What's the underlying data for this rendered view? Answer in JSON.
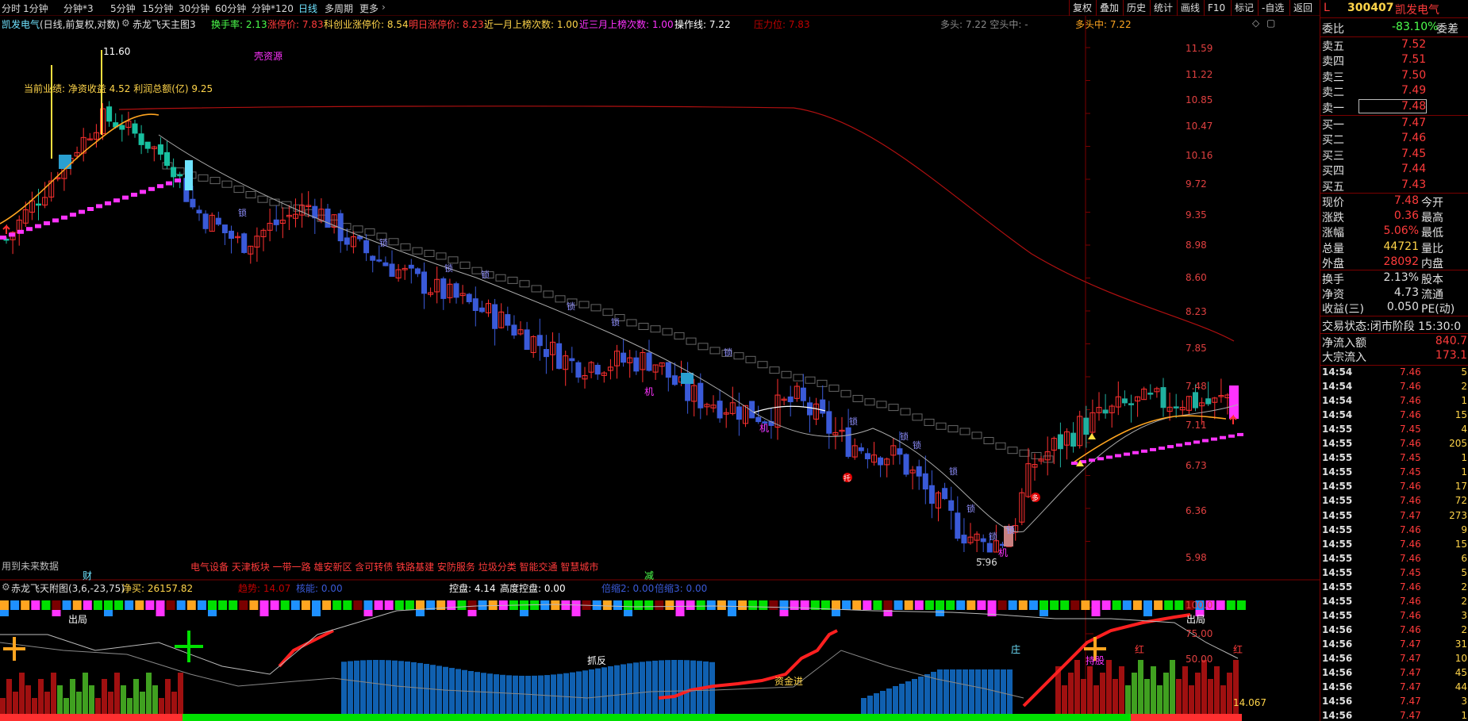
{
  "toolbar": {
    "periods": [
      "分时",
      "1分钟",
      "分钟*3",
      "5分钟",
      "15分钟",
      "30分钟",
      "60分钟",
      "分钟*120",
      "日线",
      "多周期",
      "更多"
    ],
    "active_period": "日线",
    "buttons": [
      "复权",
      "叠加",
      "历史",
      "统计",
      "画线",
      "F10",
      "标记",
      "-自选",
      "返回"
    ]
  },
  "info": {
    "stock_name": "凯发电气",
    "fq_mode": "(日线,前复权,对数)",
    "main_indicator": "赤龙飞天主图3",
    "turnover": "换手率: 2.13",
    "limit_up": "涨停价: 7.83",
    "kc_limit": "科创业涨停价: 8.54",
    "next_limit": "明日涨停价: 8.23",
    "m1_count": "近一月上榜次数: 1.00",
    "m3_count": "近三月上榜次数: 1.00",
    "op_line": "操作线: 7.22",
    "pressure": "压力位: 7.83",
    "bull_empty": "多头: 7.22  空头中: -",
    "bull_mid": "多头中: 7.22"
  },
  "chart": {
    "y_ticks": [
      "11.59",
      "11.22",
      "10.85",
      "10.47",
      "10.16",
      "9.72",
      "9.35",
      "8.98",
      "8.60",
      "8.23",
      "7.85",
      "7.48",
      "7.11",
      "6.73",
      "6.36",
      "5.98"
    ],
    "high_label": "11.60",
    "low_label": "5.96",
    "shell_label": "壳资源",
    "perf_label": "当前业绩: 净资收益 4.52 利润总额(亿) 9.25",
    "future_label": "用到未来数据",
    "cai_label": "财",
    "jian_label": "减",
    "concepts": "电气设备 天津板块 一带一路 雄安新区 含可转债 铁路基建 安防服务 垃圾分类 智能交通 智慧城市",
    "suo_label": "锁",
    "ji_label": "机",
    "tuo_label": "托",
    "duo_label": "多"
  },
  "sub": {
    "title": "赤龙飞天附图(3,6,-23,75)",
    "net_buy": "净买: 26157.82",
    "trend": "趋势: 14.07",
    "kinetic": "核能: 0.00",
    "control": "控盘: 4.14",
    "high_control": "高度控盘: 0.00",
    "shrink2": "倍缩2: 0.00",
    "shrink3": "倍缩3: 0.00",
    "y_ticks": [
      "100.0",
      "75.00",
      "50.00"
    ],
    "out_label": "出局",
    "zhuafan": "抓反",
    "zijin": "资金进",
    "zhuang": "庄",
    "chigu": "持股",
    "hong": "红",
    "value_label": "14.067"
  },
  "quote": {
    "code": "300407",
    "name": "凯发电气",
    "ratio_label": "委比",
    "ratio_value": "-83.10%",
    "diff_label": "委差",
    "asks": [
      {
        "label": "卖五",
        "price": "7.52"
      },
      {
        "label": "卖四",
        "price": "7.51"
      },
      {
        "label": "卖三",
        "price": "7.50"
      },
      {
        "label": "卖二",
        "price": "7.49"
      },
      {
        "label": "卖一",
        "price": "7.48"
      }
    ],
    "bids": [
      {
        "label": "买一",
        "price": "7.47"
      },
      {
        "label": "买二",
        "price": "7.46"
      },
      {
        "label": "买三",
        "price": "7.45"
      },
      {
        "label": "买四",
        "price": "7.44"
      },
      {
        "label": "买五",
        "price": "7.43"
      }
    ],
    "stats": [
      {
        "label": "现价",
        "value": "7.48",
        "label2": "今开",
        "color": "#ff3b3b"
      },
      {
        "label": "涨跌",
        "value": "0.36",
        "label2": "最高",
        "color": "#ff3b3b"
      },
      {
        "label": "涨幅",
        "value": "5.06%",
        "label2": "最低",
        "color": "#ff3b3b"
      },
      {
        "label": "总量",
        "value": "44721",
        "label2": "量比",
        "color": "#ffd54a"
      },
      {
        "label": "外盘",
        "value": "28092",
        "label2": "内盘",
        "color": "#ff3b3b"
      }
    ],
    "stats2": [
      {
        "label": "换手",
        "value": "2.13%",
        "label2": "股本",
        "color": "#e0e0e0"
      },
      {
        "label": "净资",
        "value": "4.73",
        "label2": "流通",
        "color": "#e0e0e0"
      },
      {
        "label": "收益(三)",
        "value": "0.050",
        "label2": "PE(动)",
        "color": "#e0e0e0"
      }
    ],
    "trade_state": "交易状态:闭市阶段 15:30:0",
    "net_inflow_label": "净流入额",
    "net_inflow_value": "840.7",
    "block_inflow_label": "大宗流入",
    "block_inflow_value": "173.1",
    "ticks": [
      {
        "t": "14:54",
        "p": "7.46",
        "v": "5",
        "c": "#ff3b3b"
      },
      {
        "t": "14:54",
        "p": "7.46",
        "v": "2",
        "c": "#ff3b3b"
      },
      {
        "t": "14:54",
        "p": "7.46",
        "v": "1",
        "c": "#ff3b3b"
      },
      {
        "t": "14:54",
        "p": "7.46",
        "v": "15",
        "c": "#ff3b3b"
      },
      {
        "t": "14:55",
        "p": "7.45",
        "v": "4",
        "c": "#ff3b3b"
      },
      {
        "t": "14:55",
        "p": "7.46",
        "v": "205",
        "c": "#ff3b3b"
      },
      {
        "t": "14:55",
        "p": "7.45",
        "v": "1",
        "c": "#ff3b3b"
      },
      {
        "t": "14:55",
        "p": "7.45",
        "v": "1",
        "c": "#ff3b3b"
      },
      {
        "t": "14:55",
        "p": "7.46",
        "v": "17",
        "c": "#ff3b3b"
      },
      {
        "t": "14:55",
        "p": "7.46",
        "v": "72",
        "c": "#ff3b3b"
      },
      {
        "t": "14:55",
        "p": "7.47",
        "v": "273",
        "c": "#ff3b3b"
      },
      {
        "t": "14:55",
        "p": "7.46",
        "v": "9",
        "c": "#ff3b3b"
      },
      {
        "t": "14:55",
        "p": "7.46",
        "v": "15",
        "c": "#ff3b3b"
      },
      {
        "t": "14:55",
        "p": "7.46",
        "v": "6",
        "c": "#ff3b3b"
      },
      {
        "t": "14:55",
        "p": "7.45",
        "v": "5",
        "c": "#ff3b3b"
      },
      {
        "t": "14:55",
        "p": "7.46",
        "v": "2",
        "c": "#ff3b3b"
      },
      {
        "t": "14:55",
        "p": "7.46",
        "v": "2",
        "c": "#ff3b3b"
      },
      {
        "t": "14:55",
        "p": "7.46",
        "v": "3",
        "c": "#ff3b3b"
      },
      {
        "t": "14:56",
        "p": "7.46",
        "v": "2",
        "c": "#ff3b3b"
      },
      {
        "t": "14:56",
        "p": "7.47",
        "v": "31",
        "c": "#ff3b3b"
      },
      {
        "t": "14:56",
        "p": "7.47",
        "v": "10",
        "c": "#ff3b3b"
      },
      {
        "t": "14:56",
        "p": "7.47",
        "v": "45",
        "c": "#ff3b3b"
      },
      {
        "t": "14:56",
        "p": "7.47",
        "v": "44",
        "c": "#ff3b3b"
      },
      {
        "t": "14:56",
        "p": "7.47",
        "v": "3",
        "c": "#ff3b3b"
      },
      {
        "t": "14:56",
        "p": "7.47",
        "v": "1",
        "c": "#ff3b3b"
      }
    ]
  },
  "colors": {
    "up": "#ff3030",
    "down": "#3a5ad8",
    "magenta": "#ff33ff",
    "orange": "#ffa520",
    "cyan": "#6fe3ff",
    "border": "#7a0000"
  }
}
